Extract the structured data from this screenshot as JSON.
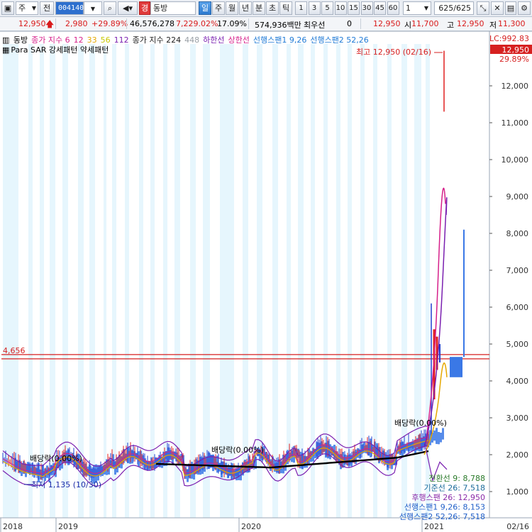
{
  "toolbar": {
    "market_prefix": "주",
    "all_label": "전",
    "code": "004140",
    "stock_tag": "경",
    "stock_name": "동방",
    "periods": [
      "일",
      "주",
      "월",
      "년",
      "분",
      "초",
      "틱"
    ],
    "active_period": "일",
    "intervals": [
      "1",
      "3",
      "5",
      "10",
      "15",
      "30",
      "45",
      "60"
    ],
    "count_value": "1",
    "page_counter": "625/625"
  },
  "quote": {
    "price": "12,950",
    "change": "2,980",
    "change_pct": "+29.89%",
    "volume": "46,576,278",
    "volume_pct": "7,229.02%",
    "turnover_pct": "17.09%",
    "amount": "574,936백만",
    "priority_label": "최우선",
    "priority_value": "0",
    "best_price": "12,950",
    "open_label": "시",
    "open": "11,700",
    "high_label": "고",
    "high": "12,950",
    "low_label": "저",
    "low": "11,300"
  },
  "legend": {
    "row1": [
      {
        "text": "동방",
        "color": "#000000"
      },
      {
        "text": "종가 지수 6",
        "color": "#d61f8a"
      },
      {
        "text": "12",
        "color": "#d61f8a"
      },
      {
        "text": "33",
        "color": "#e5a800"
      },
      {
        "text": "56",
        "color": "#c8c800"
      },
      {
        "text": "112",
        "color": "#7a1fb0"
      },
      {
        "text": "종가 지수 224",
        "color": "#222222"
      },
      {
        "text": "448",
        "color": "#9aa0a6"
      },
      {
        "text": "하한선",
        "color": "#7a1fb0"
      },
      {
        "text": "상한선",
        "color": "#d61f8a"
      },
      {
        "text": "선행스팬1 9,26",
        "color": "#1f7ad6"
      },
      {
        "text": "선행스팬2 52,26",
        "color": "#1f7ad6"
      }
    ],
    "row2": "Para SAR 강세패턴  약세패턴"
  },
  "axis": {
    "ticks": [
      "12,000",
      "11,000",
      "10,000",
      "9,000",
      "8,000",
      "7,000",
      "6,000",
      "5,000",
      "4,000",
      "3,000",
      "2,000",
      "1,000"
    ],
    "lc_label": "LC:992.83",
    "price_tag": "12,950",
    "pct_tag": "29.89%",
    "hline_value": "4,656",
    "hline_label": "4,656",
    "years": [
      "2018",
      "2019",
      "2020",
      "2021"
    ],
    "last_date": "02/16"
  },
  "annotations": {
    "high": "최고 12,950 (02/16)",
    "low": "최저 1,135 (10/30)",
    "dividend1": "배당락(0.00%)",
    "dividend2": "배당락(0.00%)",
    "dividend3": "배당락(0.00%)",
    "ichimoku": [
      {
        "text": "전환선 9: 8,788",
        "color": "#2a7a2a"
      },
      {
        "text": "기준선 26: 7,518",
        "color": "#1a6a9a"
      },
      {
        "text": "후행스팬 26: 12,950",
        "color": "#8a2aa8"
      },
      {
        "text": "선행스팬1 9,26: 8,153",
        "color": "#1f5ec8"
      },
      {
        "text": "선행스팬2 52,26: 7,518",
        "color": "#1f5ec8"
      }
    ]
  },
  "chart_data": {
    "type": "line",
    "title": "동방",
    "y_range": [
      0,
      13000
    ],
    "x": [
      "2018",
      "2019",
      "2020",
      "2021",
      "02/16"
    ],
    "series": [
      {
        "name": "동방",
        "values": [
          2000,
          1500,
          1700,
          2100,
          12950
        ]
      }
    ],
    "high": 12950,
    "low": 1135,
    "hline": 4656
  }
}
